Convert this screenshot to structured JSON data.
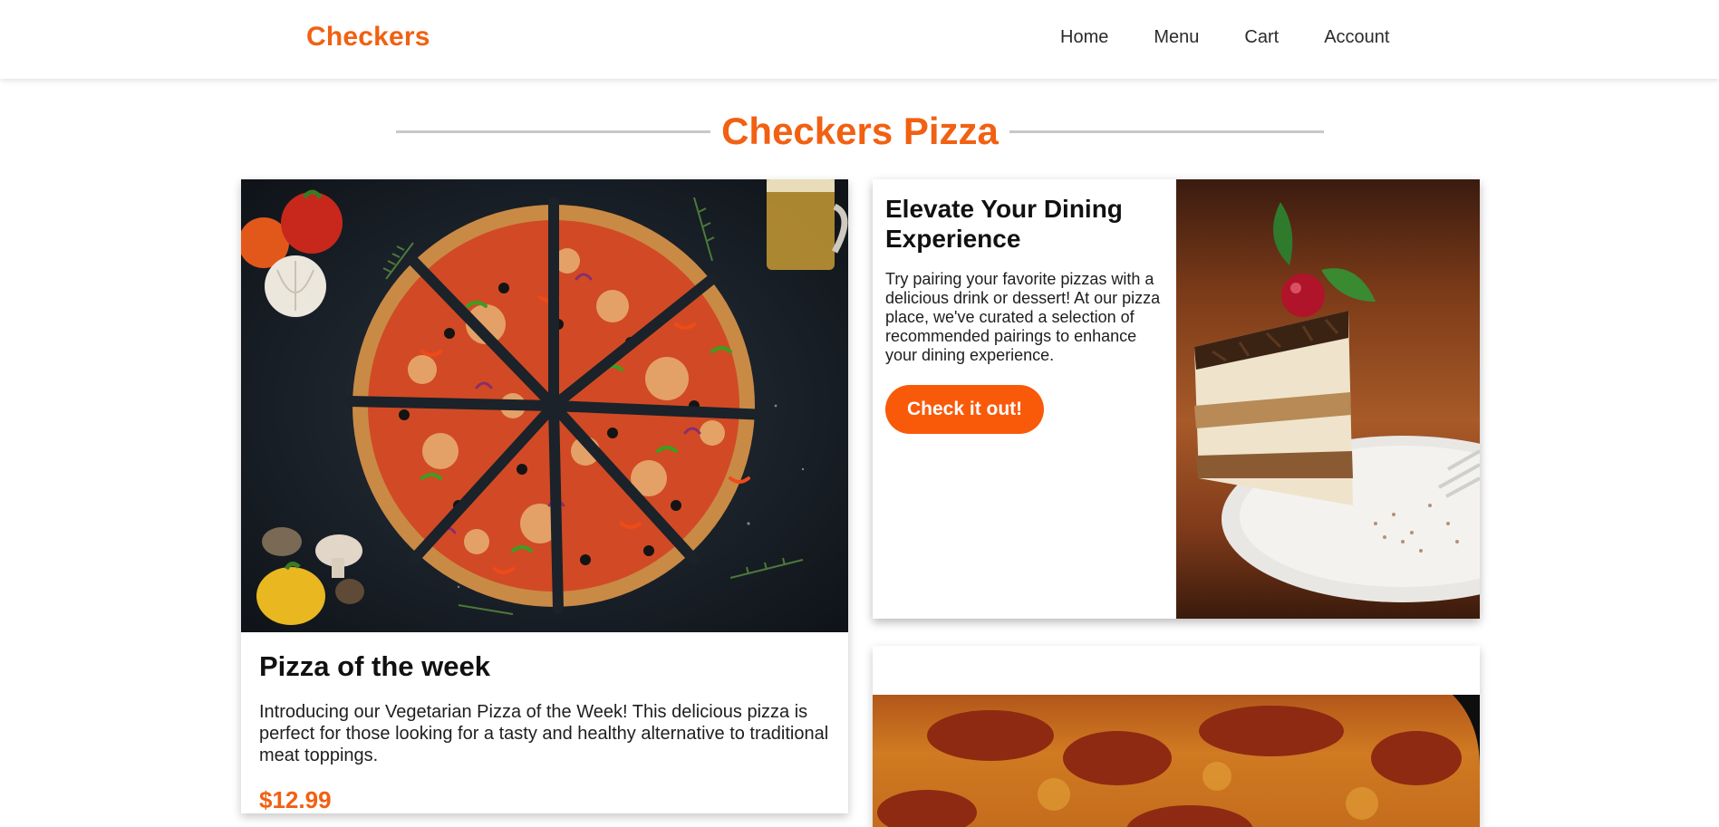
{
  "brand": "Checkers",
  "nav": [
    "Home",
    "Menu",
    "Cart",
    "Account"
  ],
  "page_title": "Checkers Pizza",
  "featured": {
    "heading": "Pizza of the week",
    "description": "Introducing our Vegetarian Pizza of the Week! This delicious pizza is perfect for those looking for a tasty and healthy alternative to traditional meat toppings.",
    "price": "$12.99"
  },
  "pairing": {
    "heading": "Elevate Your Dining Experience",
    "description": "Try pairing your favorite pizzas with a delicious drink or dessert! At our pizza place, we've curated a selection of recommended pairings to enhance your dining experience.",
    "button_label": "Check it out!"
  },
  "colors": {
    "accent": "#f26012",
    "button": "#f85a0a",
    "divider": "#c8c8c8"
  }
}
